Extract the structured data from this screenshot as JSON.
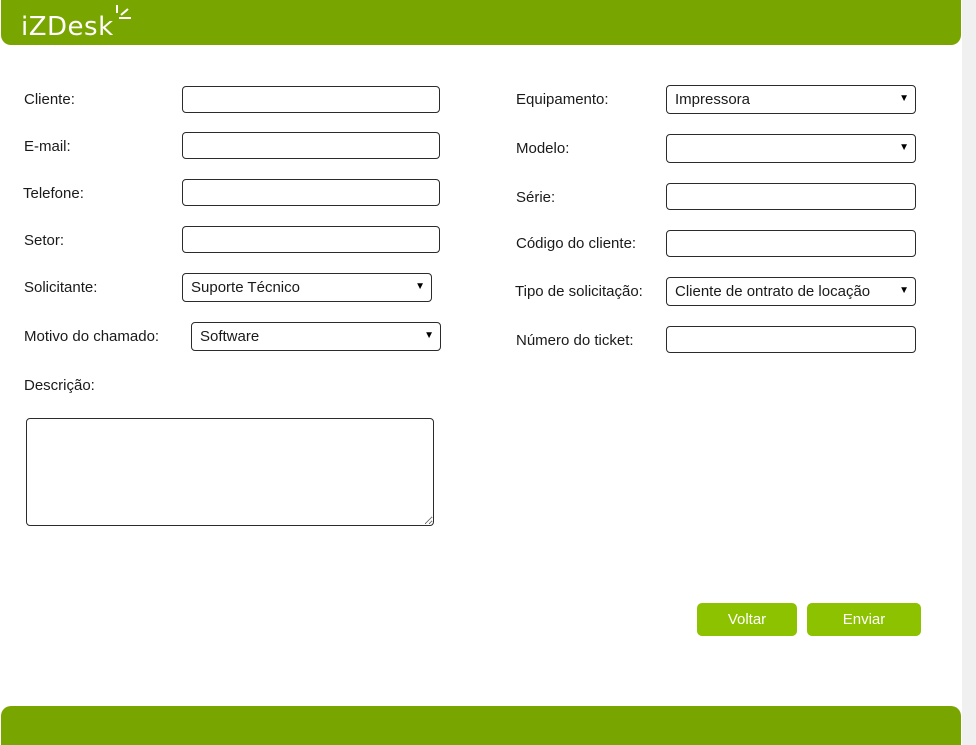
{
  "brand": {
    "logo_text": "iZDesk",
    "accent": "#78a500",
    "button_color": "#8cc200"
  },
  "form": {
    "left": {
      "cliente": {
        "label": "Cliente:",
        "value": ""
      },
      "email": {
        "label": "E-mail:",
        "value": ""
      },
      "telefone": {
        "label": "Telefone:",
        "value": ""
      },
      "setor": {
        "label": "Setor:",
        "value": ""
      },
      "solicitante": {
        "label": "Solicitante:",
        "selected": "Suporte Técnico"
      },
      "motivo": {
        "label": "Motivo do chamado:",
        "selected": "Software"
      },
      "descricao": {
        "label": "Descrição:",
        "value": ""
      }
    },
    "right": {
      "equipamento": {
        "label": "Equipamento:",
        "selected": "Impressora"
      },
      "modelo": {
        "label": "Modelo:",
        "selected": ""
      },
      "serie": {
        "label": "Série:",
        "value": ""
      },
      "codigo_cliente": {
        "label": "Código do cliente:",
        "value": ""
      },
      "tipo_solicitacao": {
        "label": "Tipo de solicitação:",
        "selected": "Cliente de ontrato de locação"
      },
      "numero_ticket": {
        "label": "Número do ticket:",
        "value": ""
      }
    }
  },
  "actions": {
    "back_label": "Voltar",
    "submit_label": "Enviar"
  },
  "icons": {
    "dropdown_arrow": "▼"
  }
}
